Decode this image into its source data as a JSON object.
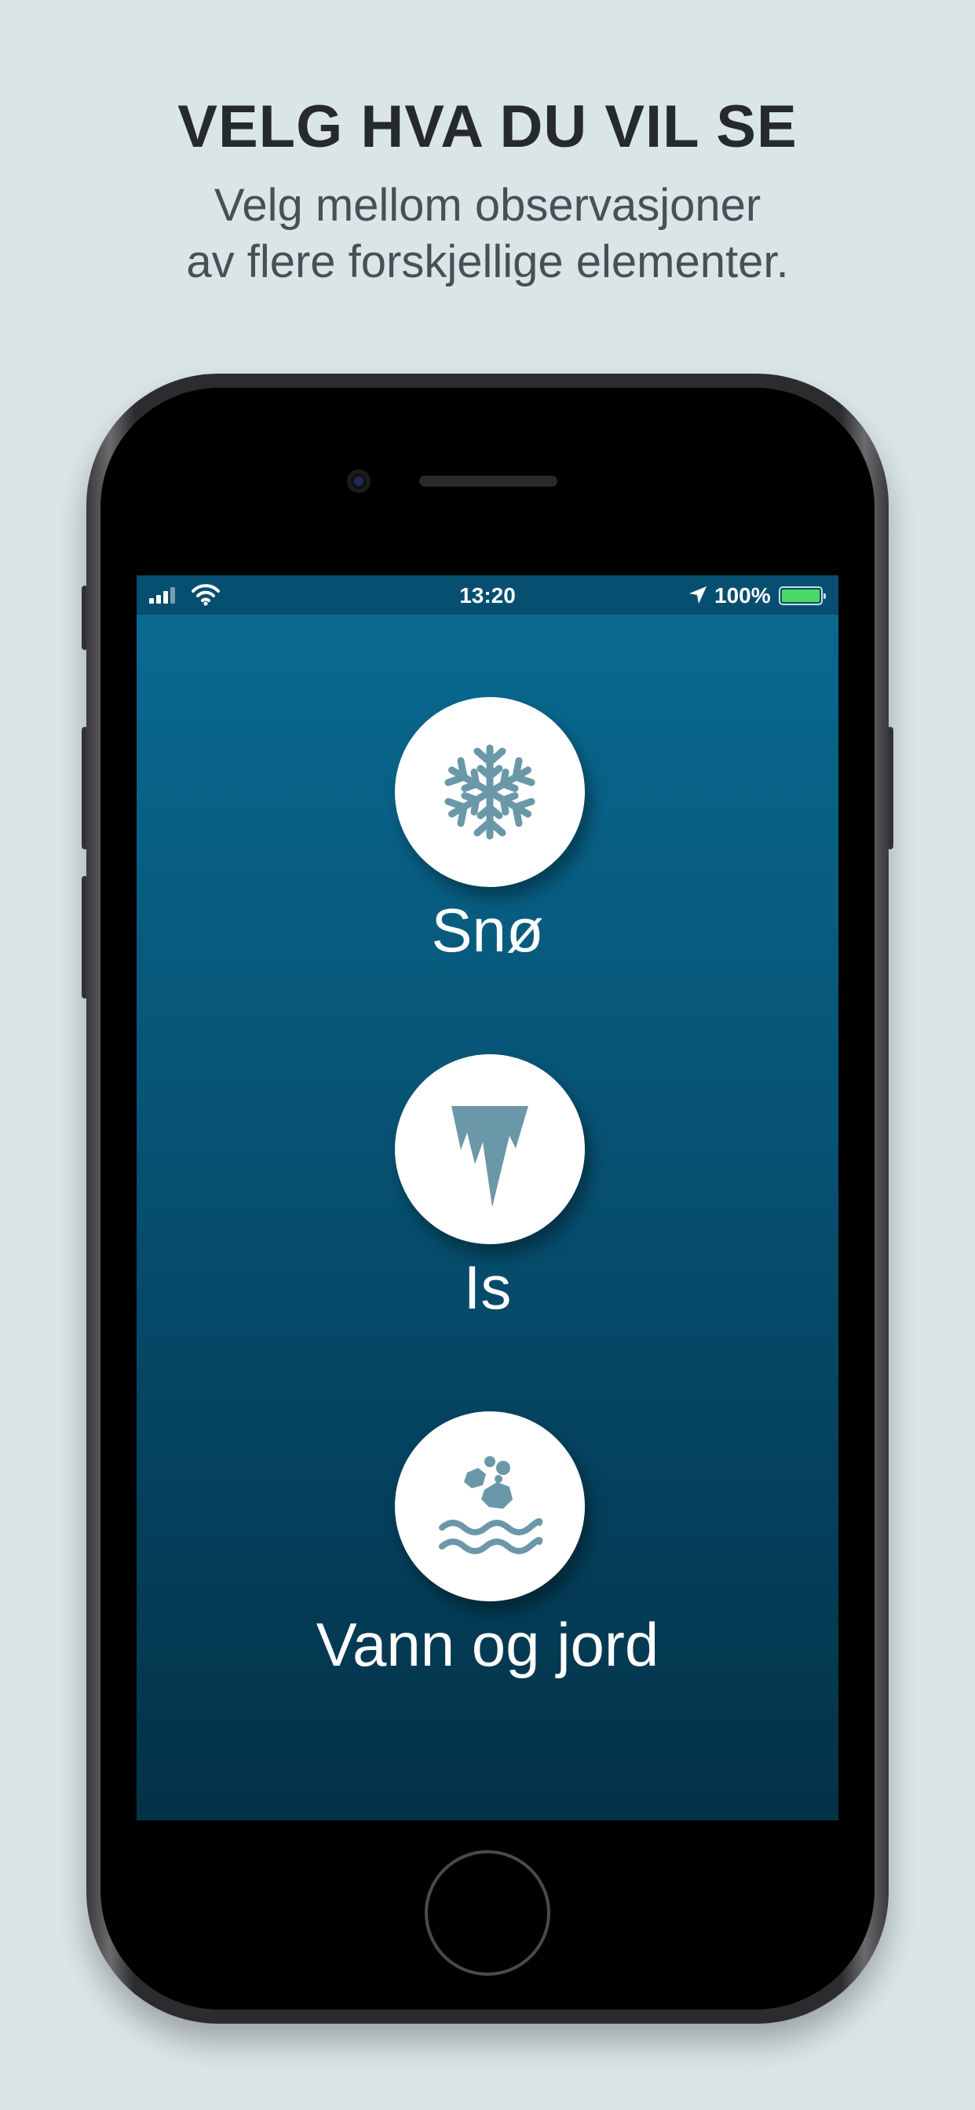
{
  "header": {
    "title": "VELG HVA DU VIL SE",
    "subtitle_line1": "Velg mellom observasjoner",
    "subtitle_line2": "av flere forskjellige elementer."
  },
  "statusbar": {
    "time": "13:20",
    "battery": "100%",
    "icons": [
      "signal-icon",
      "wifi-icon",
      "location-arrow-icon",
      "battery-icon"
    ]
  },
  "options": [
    {
      "label": "Snø",
      "icon": "snowflake-icon"
    },
    {
      "label": "Is",
      "icon": "icicle-icon"
    },
    {
      "label": "Vann og jord",
      "icon": "water-and-soil-icon"
    }
  ],
  "colors": {
    "background": "#dae5e7",
    "screen_top": "#0a6b93",
    "screen_bottom": "#033247",
    "icon": "#6a98a8",
    "battery": "#4cd964"
  }
}
